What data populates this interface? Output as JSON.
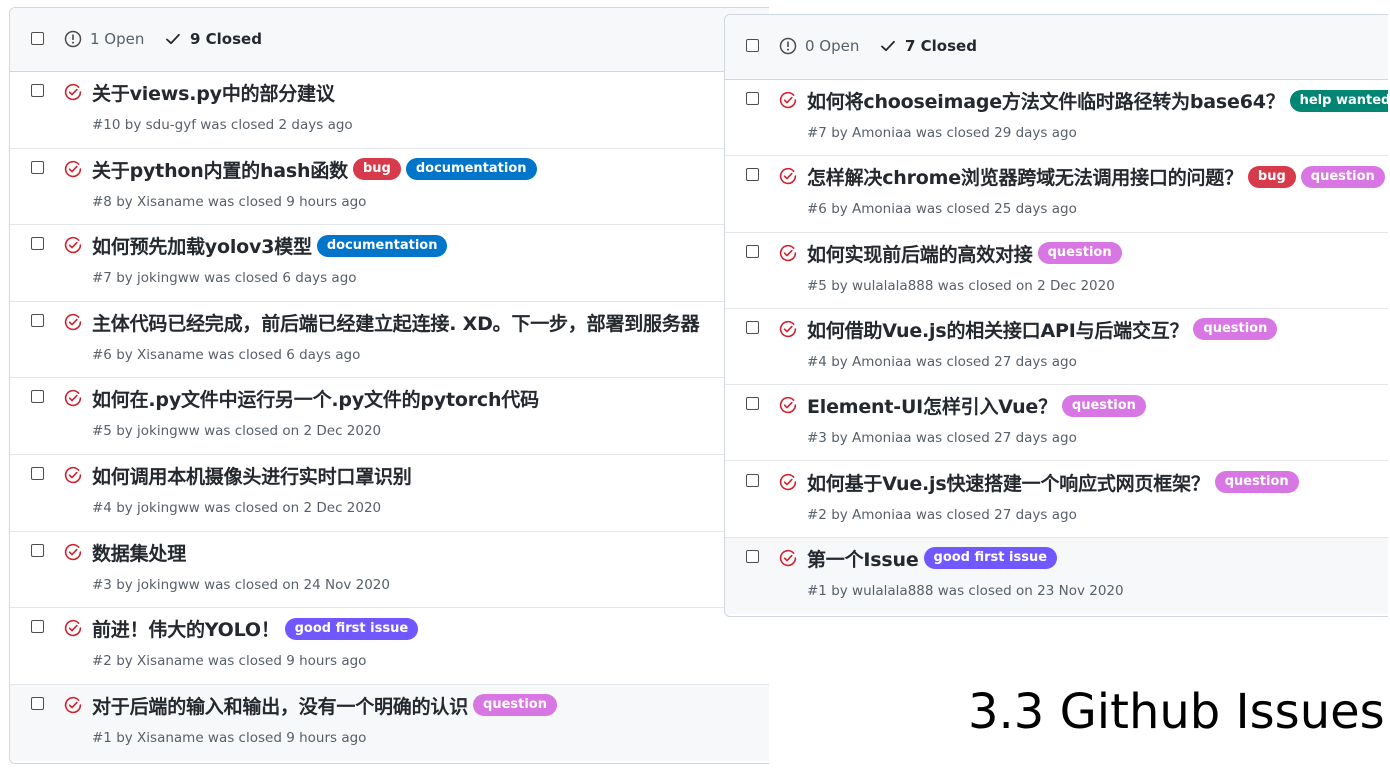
{
  "colors": {
    "closed_icon": "#cf222e",
    "muted_text": "#57606a",
    "header_bg": "#f6f8fa",
    "border": "#d0d7de"
  },
  "labels": {
    "bug": {
      "text": "bug",
      "color": "#d73a4a"
    },
    "documentation": {
      "text": "documentation",
      "color": "#0075ca"
    },
    "question": {
      "text": "question",
      "color": "#d876e3"
    },
    "good first issue": {
      "text": "good first issue",
      "color": "#7057ff"
    },
    "help wanted": {
      "text": "help wanted",
      "color": "#008672"
    }
  },
  "left": {
    "header": {
      "open_label": "1 Open",
      "closed_label": "9 Closed",
      "open_icon": "issue-opened-icon",
      "closed_icon": "check-icon"
    },
    "issues": [
      {
        "title": "关于views.py中的部分建议",
        "labels": [],
        "meta": "#10 by sdu-gyf was closed 2 days ago"
      },
      {
        "title": "关于python内置的hash函数",
        "labels": [
          "bug",
          "documentation"
        ],
        "meta": "#8 by Xisaname was closed 9 hours ago"
      },
      {
        "title": "如何预先加载yolov3模型",
        "labels": [
          "documentation"
        ],
        "meta": "#7 by jokingww was closed 6 days ago"
      },
      {
        "title": "主体代码已经完成，前后端已经建立起连接. XD。下一步，部署到服务器",
        "labels": [],
        "meta": "#6 by Xisaname was closed 6 days ago"
      },
      {
        "title": "如何在.py文件中运行另一个.py文件的pytorch代码",
        "labels": [],
        "meta": "#5 by jokingww was closed on 2 Dec 2020"
      },
      {
        "title": "如何调用本机摄像头进行实时口罩识别",
        "labels": [],
        "meta": "#4 by jokingww was closed on 2 Dec 2020"
      },
      {
        "title": "数据集处理",
        "labels": [],
        "meta": "#3 by jokingww was closed on 24 Nov 2020"
      },
      {
        "title": "前进！伟大的YOLO！",
        "labels": [
          "good first issue"
        ],
        "meta": "#2 by Xisaname was closed 9 hours ago"
      },
      {
        "title": "对于后端的输入和输出，没有一个明确的认识",
        "labels": [
          "question"
        ],
        "meta": "#1 by Xisaname was closed 9 hours ago"
      }
    ]
  },
  "right": {
    "header": {
      "open_label": "0 Open",
      "closed_label": "7 Closed",
      "open_icon": "issue-opened-icon",
      "closed_icon": "check-icon"
    },
    "issues": [
      {
        "title": "如何将chooseimage方法文件临时路径转为base64？",
        "labels": [
          "help wanted"
        ],
        "meta": "#7 by Amoniaa was closed 29 days ago"
      },
      {
        "title": "怎样解决chrome浏览器跨域无法调用接口的问题？",
        "labels": [
          "bug",
          "question"
        ],
        "meta": "#6 by Amoniaa was closed 25 days ago"
      },
      {
        "title": "如何实现前后端的高效对接",
        "labels": [
          "question"
        ],
        "meta": "#5 by wulalala888 was closed on 2 Dec 2020"
      },
      {
        "title": "如何借助Vue.js的相关接口API与后端交互？",
        "labels": [
          "question"
        ],
        "meta": "#4 by Amoniaa was closed 27 days ago"
      },
      {
        "title": "Element-UI怎样引入Vue？",
        "labels": [
          "question"
        ],
        "meta": "#3 by Amoniaa was closed 27 days ago"
      },
      {
        "title": "如何基于Vue.js快速搭建一个响应式网页框架？",
        "labels": [
          "question"
        ],
        "meta": "#2 by Amoniaa was closed 27 days ago"
      },
      {
        "title": "第一个Issue",
        "labels": [
          "good first issue"
        ],
        "meta": "#1 by wulalala888 was closed on 23 Nov 2020"
      }
    ]
  },
  "caption": "3.3 Github Issues"
}
